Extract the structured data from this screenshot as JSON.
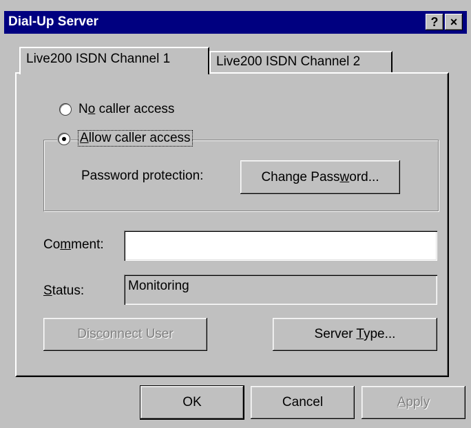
{
  "window": {
    "title": "Dial-Up Server",
    "help_glyph": "?",
    "close_glyph": "×"
  },
  "tabs": [
    {
      "label": "Live200  ISDN Channel 1",
      "active": true
    },
    {
      "label": "Live200  ISDN Channel 2",
      "active": false
    }
  ],
  "access": {
    "no_access_pre": "N",
    "no_access_ul": "o",
    "no_access_post": " caller access",
    "allow_access_pre": "",
    "allow_access_ul": "A",
    "allow_access_post": "llow caller access",
    "selected": "allow"
  },
  "password": {
    "label": "Password protection:",
    "button_pre": "Change Pass",
    "button_ul": "w",
    "button_post": "ord..."
  },
  "comment": {
    "label_pre": "Co",
    "label_ul": "m",
    "label_post": "ment:",
    "value": ""
  },
  "status": {
    "label_pre": "",
    "label_ul": "S",
    "label_post": "tatus:",
    "value": "Monitoring"
  },
  "buttons": {
    "disconnect_pre": "Dis",
    "disconnect_ul": "c",
    "disconnect_post": "onnect User",
    "server_type_pre": "Server ",
    "server_type_ul": "T",
    "server_type_post": "ype...",
    "ok": "OK",
    "cancel": "Cancel",
    "apply_pre": "",
    "apply_ul": "A",
    "apply_post": "pply"
  }
}
